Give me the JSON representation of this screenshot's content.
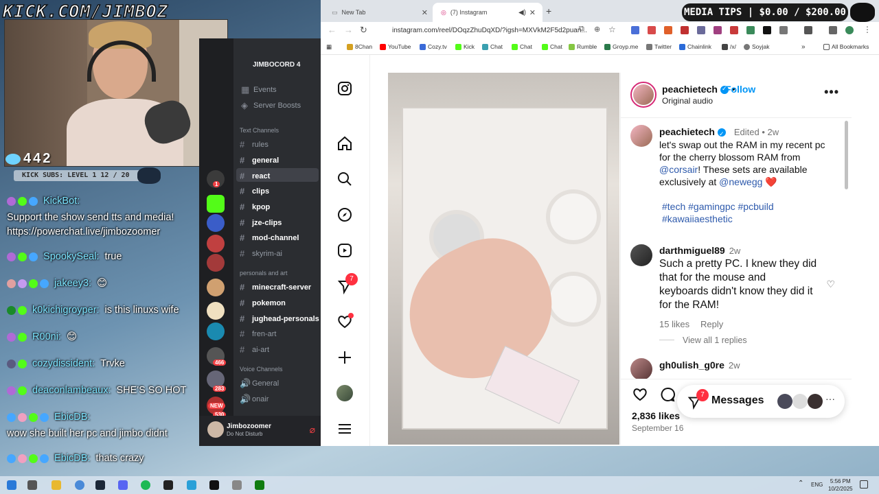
{
  "stream": {
    "title": "KICK.COM/JIMBOZ",
    "viewers": "442",
    "subs_bar": "KICK SUBS: LEVEL 1 12 / 20",
    "media_tips": "MEDIA TIPS | $0.00 / $200.00"
  },
  "chat": [
    {
      "user": "KickBot:",
      "msg": ""
    },
    {
      "user": "",
      "msg": "Support the show send tts and media!"
    },
    {
      "user": "",
      "msg": "https://powerchat.live/jimbozoomer"
    },
    {
      "user": "SpookySeal:",
      "msg": "true"
    },
    {
      "user": "jakeey3:",
      "msg": "😊"
    },
    {
      "user": "k0kichigroyper:",
      "msg": "is this linuxs wife"
    },
    {
      "user": "R00ni:",
      "msg": "😊"
    },
    {
      "user": "cozydissident:",
      "msg": "Trvke"
    },
    {
      "user": "deaconlambeaux:",
      "msg": "SHE'S SO HOT"
    },
    {
      "user": "EbicDB:",
      "msg": ""
    },
    {
      "user": "",
      "msg": "wow she built her pc and jimbo didnt"
    },
    {
      "user": "EbicDB:",
      "msg": "thats crazy"
    }
  ],
  "discord": {
    "server_name": "JIMBOCORD 4",
    "top_items": [
      "Events",
      "Server Boosts"
    ],
    "categories": {
      "text": "Text Channels",
      "pa": "personals and art",
      "voice": "Voice Channels"
    },
    "text_channels": [
      "rules",
      "general",
      "react",
      "clips",
      "kpop",
      "jze-clips",
      "mod-channel",
      "skyrim-ai"
    ],
    "pa_channels": [
      "minecraft-server",
      "pokemon",
      "jughead-personals",
      "fren-art",
      "ai-art"
    ],
    "voice_channels": [
      "General",
      "onair"
    ],
    "server_badges": [
      "1",
      "466",
      "283",
      "530"
    ],
    "server_new": "NEW",
    "user": {
      "name": "Jimbozoomer",
      "status": "Do Not Disturb"
    }
  },
  "browser": {
    "tabs": [
      {
        "label": "New Tab"
      },
      {
        "label": "(7) Instagram"
      }
    ],
    "url": "instagram.com/reel/DOqzZhuDqXD/?igsh=MXVkM2F5d2puan...",
    "bookmarks": [
      "8Chan",
      "YouTube",
      "Cozy.tv",
      "Kick",
      "Chat",
      "Chat",
      "Chat",
      "Rumble",
      "Groyp.me",
      "Twitter",
      "Chainlink",
      "/x/",
      "Soyjak"
    ],
    "all_bookmarks": "All Bookmarks"
  },
  "instagram": {
    "notification_count": "7",
    "header": {
      "username": "peachietech",
      "follow": "Follow",
      "audio": "Original audio",
      "more": "•••"
    },
    "caption": {
      "username": "peachietech",
      "edited": "Edited",
      "time": "2w",
      "text1": "let's swap out the RAM in my recent pc for the cherry blossom RAM from ",
      "mention1": "@corsair",
      "text2": "! These sets are available exclusively at ",
      "mention2": "@newegg",
      "heart": "❤️",
      "tags1": "#tech #gamingpc #pcbuild",
      "tags2": "#kawaiiaesthetic"
    },
    "comment1": {
      "username": "darthmiguel89",
      "time": "2w",
      "text": "Such a pretty PC. I knew they did that for the mouse and keyboards didn't know they did it for the RAM!",
      "likes": "15 likes",
      "reply": "Reply",
      "view_replies": "View all 1 replies"
    },
    "comment2": {
      "username": "gh0ulish_g0re",
      "time": "2w"
    },
    "likes": "2,836 likes",
    "date": "September 16",
    "messages": {
      "label": "Messages",
      "badge": "7",
      "more": "···"
    }
  },
  "taskbar": {
    "lang": "ENG",
    "time": "5:56 PM",
    "date": "10/2/2025"
  }
}
